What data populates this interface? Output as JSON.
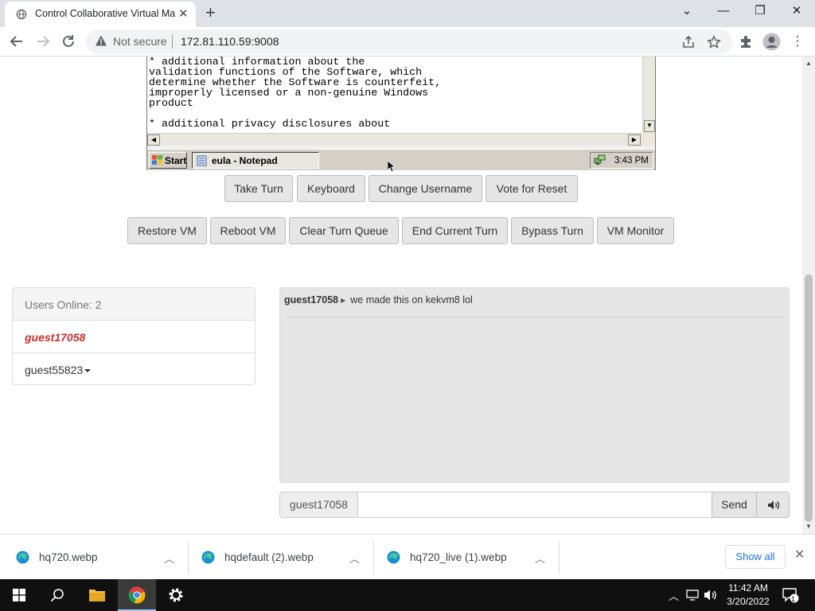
{
  "browser": {
    "tab_title": "Control Collaborative Virtual Ma",
    "security_label": "Not secure",
    "url": "172.81.110.59:9008"
  },
  "vm": {
    "notepad_text": "* additional information about the\nvalidation functions of the Software, which\ndetermine whether the Software is counterfeit,\nimproperly licensed or a non-genuine Windows\nproduct\n\n* additional privacy disclosures about",
    "start_label": "Start",
    "task_label": "eula - Notepad",
    "clock": "3:43 PM"
  },
  "controls": {
    "row1": [
      "Take Turn",
      "Keyboard",
      "Change Username",
      "Vote for Reset"
    ],
    "row2": [
      "Restore VM",
      "Reboot VM",
      "Clear Turn Queue",
      "End Current Turn",
      "Bypass Turn",
      "VM Monitor"
    ]
  },
  "users": {
    "header": "Users Online: 2",
    "list": [
      "guest17058",
      "guest55823"
    ]
  },
  "chat": {
    "messages": [
      {
        "user": "guest17058",
        "text": "we made this on kekvm8 lol"
      }
    ],
    "username": "guest17058",
    "input_value": "",
    "send_label": "Send"
  },
  "downloads": {
    "items": [
      "hq720.webp",
      "hqdefault (2).webp",
      "hq720_live (1).webp"
    ],
    "show_all": "Show all"
  },
  "taskbar": {
    "time": "11:42 AM",
    "date": "3/20/2022",
    "notification_count": "1"
  }
}
